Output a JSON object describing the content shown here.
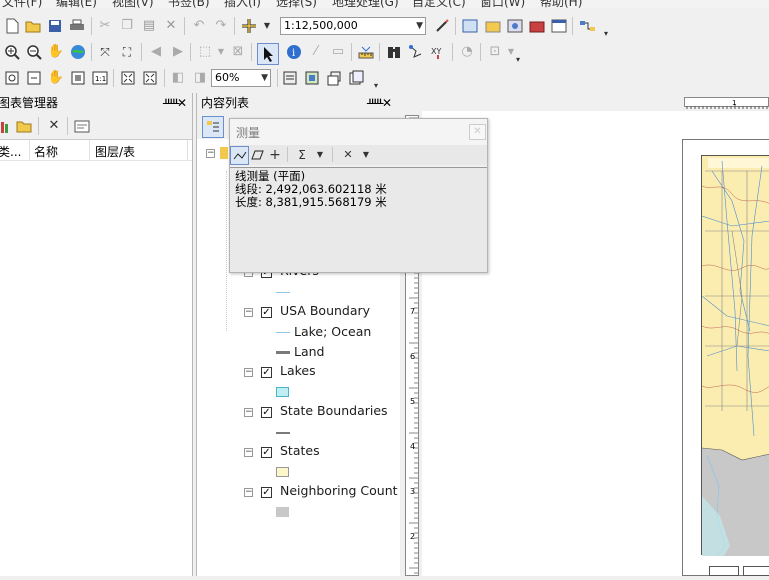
{
  "menubar": [
    "文件(F)",
    "编辑(E)",
    "视图(V)",
    "书签(B)",
    "插入(I)",
    "选择(S)",
    "地理处理(G)",
    "自定义(C)",
    "窗口(W)",
    "帮助(H)"
  ],
  "toolbar": {
    "scale_value": "1:12,500,000",
    "zoom_value": "60%"
  },
  "chart_manager": {
    "title": "图表管理器",
    "columns": [
      "类...",
      "名称",
      "图层/表"
    ]
  },
  "toc": {
    "title": "内容列表",
    "layers": [
      {
        "name": "Rivers"
      },
      {
        "name": "USA Boundary",
        "legend": [
          "Lake; Ocean",
          "Land"
        ]
      },
      {
        "name": "Lakes"
      },
      {
        "name": "State Boundaries"
      },
      {
        "name": "States"
      },
      {
        "name": "Neighboring Countries"
      }
    ]
  },
  "measure": {
    "title": "测量",
    "result_title": "线测量 (平面)",
    "segment_label": "线段:",
    "segment_value": "2,492,063.602118 米",
    "length_label": "长度:",
    "length_value": "8,381,915.568179 米"
  },
  "ruler": {
    "vertical_labels": [
      "7",
      "6",
      "5",
      "4",
      "3",
      "2"
    ]
  },
  "colors": {
    "lake": "#bfeef4",
    "land": "#7a7a7a",
    "state": "#fdf6c8",
    "neighbor": "#c8c8c8",
    "river": "#8fc6e6"
  }
}
